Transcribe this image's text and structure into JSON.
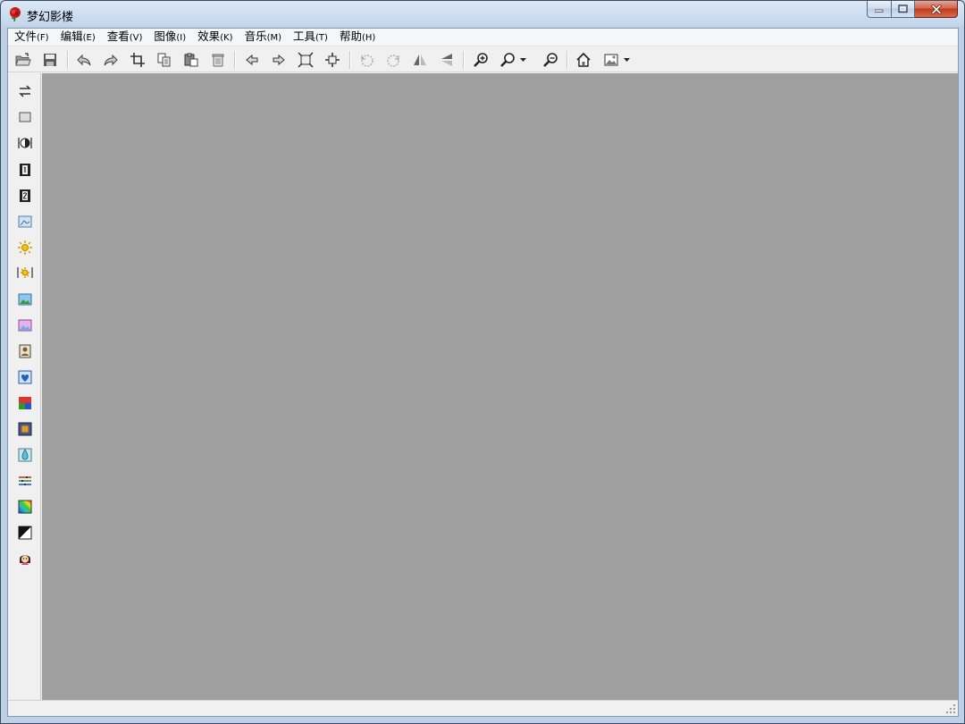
{
  "window": {
    "title": "梦幻影楼",
    "app_icon": "red-rose-icon",
    "caption_buttons": [
      "minimize-icon",
      "maximize-icon",
      "close-icon"
    ]
  },
  "menubar": {
    "items": [
      {
        "label": "文件",
        "accel": "(F)"
      },
      {
        "label": "编辑",
        "accel": "(E)"
      },
      {
        "label": "查看",
        "accel": "(V)"
      },
      {
        "label": "图像",
        "accel": "(I)"
      },
      {
        "label": "效果",
        "accel": "(K)"
      },
      {
        "label": "音乐",
        "accel": "(M)"
      },
      {
        "label": "工具",
        "accel": "(T)"
      },
      {
        "label": "帮助",
        "accel": "(H)"
      }
    ]
  },
  "toolbar": {
    "buttons": [
      "open-folder-icon",
      "save-icon",
      "undo-icon",
      "redo-icon",
      "crop-icon",
      "copy-icon",
      "paste-icon",
      "delete-icon",
      "previous-arrow-icon",
      "next-arrow-icon",
      "fit-window-icon",
      "actual-size-icon",
      "rotate-left-icon",
      "rotate-right-icon",
      "flip-horizontal-icon",
      "flip-vertical-icon",
      "zoom-in-icon",
      "zoom-icon",
      "zoom-out-icon",
      "home-icon",
      "image-icon"
    ]
  },
  "sidepanel": {
    "tools": [
      "swap-arrows-icon",
      "frame-icon",
      "contrast-icon",
      "layer-1-icon",
      "layer-2-icon",
      "image-adjust-icon",
      "brightness-icon",
      "sparkle-adjust-icon",
      "landscape-icon",
      "color-landscape-icon",
      "portrait-icon",
      "heart-frame-icon",
      "color-gradient-icon",
      "ornate-frame-icon",
      "water-drop-icon",
      "color-balance-icon",
      "rainbow-icon",
      "black-white-icon",
      "face-icon"
    ]
  },
  "colors": {
    "canvas": "#a0a0a0",
    "panel": "#f0f0f0",
    "title_bar": "#c5d7ec",
    "close_button": "#c0391d"
  }
}
